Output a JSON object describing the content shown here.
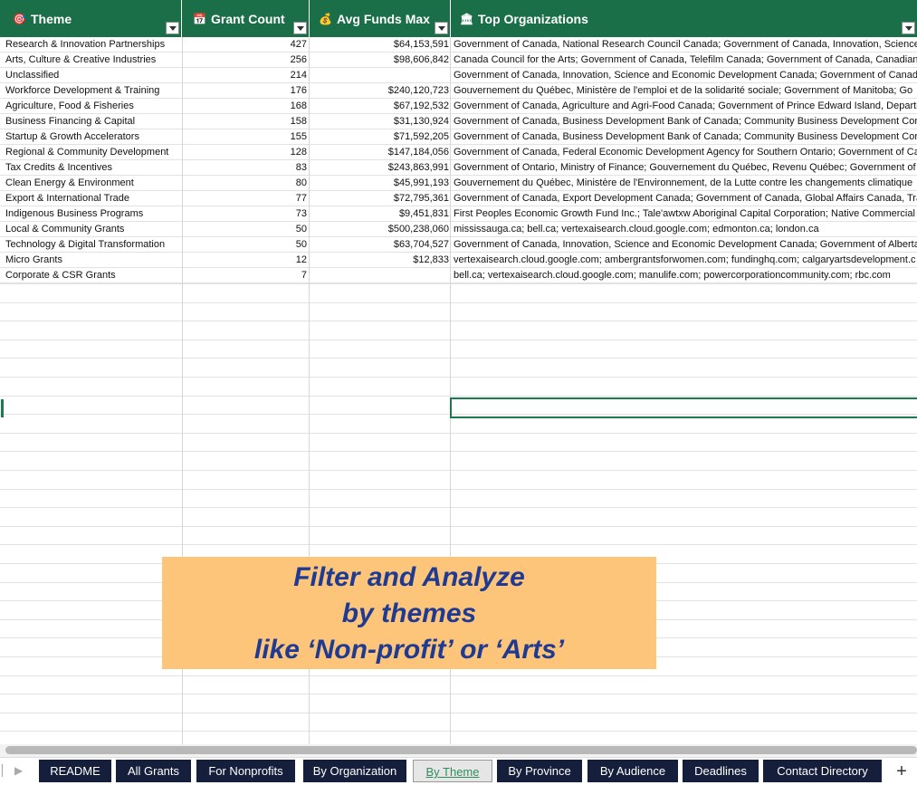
{
  "header": {
    "theme": {
      "label": "Theme",
      "icon": "target-icon"
    },
    "grant_count": {
      "label": "Grant Count",
      "icon": "calendar-icon"
    },
    "avg_funds": {
      "label": "Avg Funds Max",
      "icon": "money-bag-icon"
    },
    "top_orgs": {
      "label": "Top Organizations",
      "icon": "bank-icon"
    }
  },
  "rows": [
    {
      "theme": "Research & Innovation Partnerships",
      "count": "427",
      "funds": "$64,153,591",
      "orgs": "Government of Canada, National Research Council Canada; Government of Canada, Innovation, Science a"
    },
    {
      "theme": "Arts, Culture & Creative Industries",
      "count": "256",
      "funds": "$98,606,842",
      "orgs": "Canada Council for the Arts; Government of Canada, Telefilm Canada; Government of Canada, Canadian"
    },
    {
      "theme": "Unclassified",
      "count": "214",
      "funds": "",
      "orgs": "Government of Canada, Innovation, Science and Economic Development Canada; Government of Canada,"
    },
    {
      "theme": "Workforce Development & Training",
      "count": "176",
      "funds": "$240,120,723",
      "orgs": "Gouvernement du Québec, Ministère de l'emploi et de la solidarité sociale; Government of Manitoba; Go"
    },
    {
      "theme": "Agriculture, Food & Fisheries",
      "count": "168",
      "funds": "$67,192,532",
      "orgs": "Government of Canada, Agriculture and Agri-Food Canada; Government of Prince Edward Island, Departm"
    },
    {
      "theme": "Business Financing & Capital",
      "count": "158",
      "funds": "$31,130,924",
      "orgs": "Government of Canada, Business Development Bank of Canada; Community Business Development Corpo"
    },
    {
      "theme": "Startup & Growth Accelerators",
      "count": "155",
      "funds": "$71,592,205",
      "orgs": "Government of Canada, Business Development Bank of Canada; Community Business Development Corpo"
    },
    {
      "theme": "Regional & Community Development",
      "count": "128",
      "funds": "$147,184,056",
      "orgs": "Government of Canada, Federal Economic Development Agency for Southern Ontario; Government of Ca"
    },
    {
      "theme": "Tax Credits & Incentives",
      "count": "83",
      "funds": "$243,863,991",
      "orgs": "Government of Ontario, Ministry of Finance; Gouvernement du Québec, Revenu Québec; Government of"
    },
    {
      "theme": "Clean Energy & Environment",
      "count": "80",
      "funds": "$45,991,193",
      "orgs": "Gouvernement du Québec, Ministère de l'Environnement, de la Lutte contre les changements climatique"
    },
    {
      "theme": "Export & International Trade",
      "count": "77",
      "funds": "$72,795,361",
      "orgs": "Government of Canada, Export Development Canada; Government of Canada, Global Affairs Canada, Trad"
    },
    {
      "theme": "Indigenous Business Programs",
      "count": "73",
      "funds": "$9,451,831",
      "orgs": "First Peoples Economic Growth Fund Inc.; Tale'awtxw Aboriginal Capital Corporation; Native Commercial"
    },
    {
      "theme": "Local & Community Grants",
      "count": "50",
      "funds": "$500,238,060",
      "orgs": "mississauga.ca; bell.ca; vertexaisearch.cloud.google.com; edmonton.ca; london.ca"
    },
    {
      "theme": "Technology & Digital Transformation",
      "count": "50",
      "funds": "$63,704,527",
      "orgs": "Government of Canada, Innovation, Science and Economic Development Canada; Government of Alberta,"
    },
    {
      "theme": "Micro Grants",
      "count": "12",
      "funds": "$12,833",
      "orgs": "vertexaisearch.cloud.google.com; ambergrantsforwomen.com; fundinghq.com; calgaryartsdevelopment.c"
    },
    {
      "theme": "Corporate & CSR Grants",
      "count": "7",
      "funds": "",
      "orgs": "bell.ca; vertexaisearch.cloud.google.com; manulife.com; powercorporationcommunity.com; rbc.com"
    }
  ],
  "banner": {
    "line1": "Filter and Analyze",
    "line2": "by themes",
    "line3": "like ‘Non-profit’ or ‘Arts’"
  },
  "tabs": [
    {
      "label": "README",
      "active": false
    },
    {
      "label": "All Grants",
      "active": false
    },
    {
      "label": "For Nonprofits",
      "active": false
    },
    {
      "label": "By Organization",
      "active": false
    },
    {
      "label": "By Theme",
      "active": true
    },
    {
      "label": "By Province",
      "active": false
    },
    {
      "label": "By Audience",
      "active": false
    },
    {
      "label": "Deadlines",
      "active": false
    },
    {
      "label": "Contact Directory",
      "active": false
    }
  ],
  "add_sheet_label": "+",
  "colors": {
    "header_bg": "#1a6e48",
    "tab_bg": "#151e3b",
    "banner_bg": "#fcc57a",
    "banner_text": "#1f3a93"
  }
}
